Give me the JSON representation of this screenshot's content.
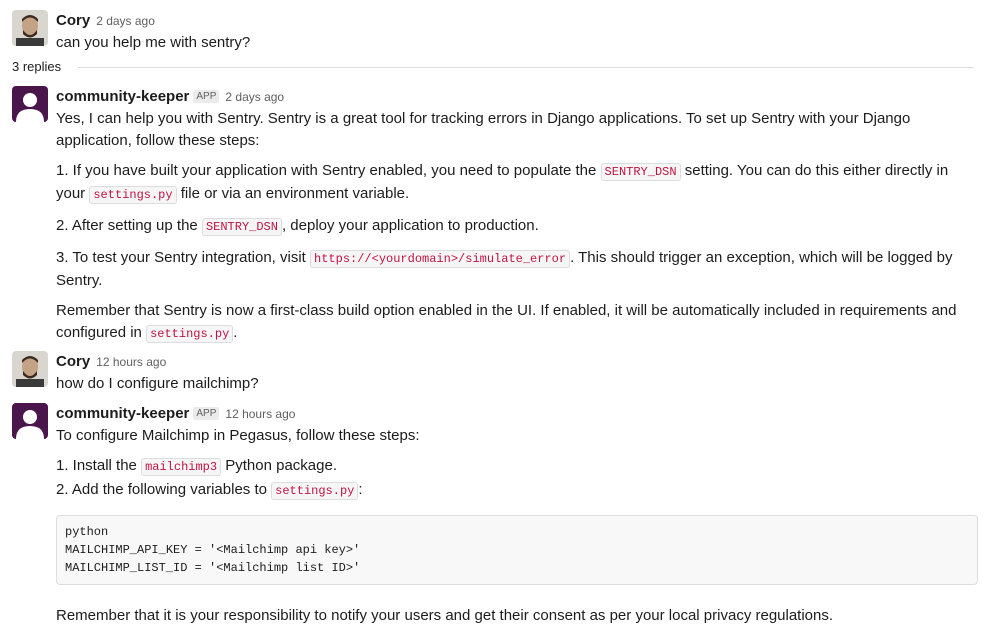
{
  "thread": {
    "replies_label": "3 replies",
    "code_color": "#c01343",
    "app_badge": "APP",
    "root": {
      "author": "Cory",
      "timestamp": "2 days ago",
      "text": "can you help me with sentry?"
    },
    "reply1": {
      "author": "community-keeper",
      "timestamp": "2 days ago",
      "intro": "Yes, I can help you with Sentry. Sentry is a great tool for tracking errors in Django applications. To set up Sentry with your Django application, follow these steps:",
      "step1_a": "1. If you have built your application with Sentry enabled, you need to populate the ",
      "step1_code1": "SENTRY_DSN",
      "step1_b": " setting. You can do this either directly in your ",
      "step1_code2": "settings.py",
      "step1_c": " file or via an environment variable.",
      "step2_a": "2. After setting up the ",
      "step2_code": "SENTRY_DSN",
      "step2_b": ", deploy your application to production.",
      "step3_a": "3. To test your Sentry integration, visit ",
      "step3_code": "https://<yourdomain>/simulate_error",
      "step3_b": ". This should trigger an exception, which will be logged by Sentry.",
      "outro_a": "Remember that Sentry is now a first-class build option enabled in the UI. If enabled, it will be automatically included in requirements and configured in ",
      "outro_code": "settings.py",
      "outro_b": "."
    },
    "reply2": {
      "author": "Cory",
      "timestamp": "12 hours ago",
      "text": "how do I configure mailchimp?"
    },
    "reply3": {
      "author": "community-keeper",
      "timestamp": "12 hours ago",
      "intro": "To configure Mailchimp in Pegasus, follow these steps:",
      "step1_a": "1. Install the ",
      "step1_code": "mailchimp3",
      "step1_b": " Python package.",
      "step2_a": "2. Add the following variables to ",
      "step2_code": "settings.py",
      "step2_b": ":",
      "code_block": "python\nMAILCHIMP_API_KEY = '<Mailchimp api key>'\nMAILCHIMP_LIST_ID = '<Mailchimp list ID>'",
      "outro": "Remember that it is your responsibility to notify your users and get their consent as per your local privacy regulations."
    }
  }
}
